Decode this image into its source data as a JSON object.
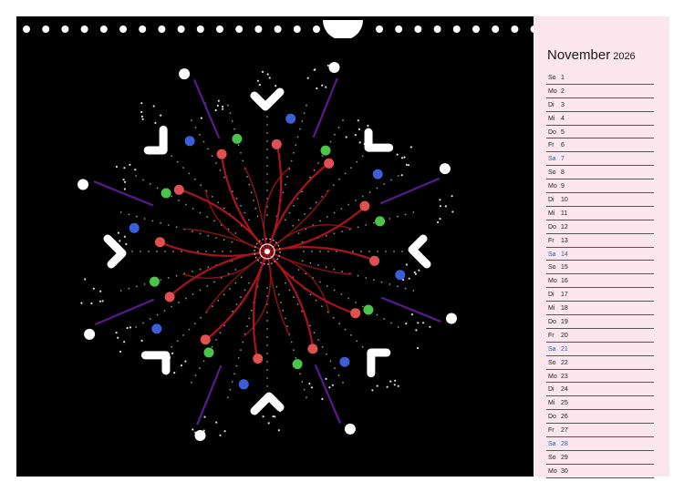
{
  "calendar": {
    "month": "November",
    "year": "2026",
    "days": [
      {
        "weekday": "So",
        "day": "1"
      },
      {
        "weekday": "Mo",
        "day": "2"
      },
      {
        "weekday": "Di",
        "day": "3"
      },
      {
        "weekday": "Mi",
        "day": "4"
      },
      {
        "weekday": "Do",
        "day": "5"
      },
      {
        "weekday": "Fr",
        "day": "6"
      },
      {
        "weekday": "Sa",
        "day": "7"
      },
      {
        "weekday": "So",
        "day": "8"
      },
      {
        "weekday": "Mo",
        "day": "9"
      },
      {
        "weekday": "Di",
        "day": "10"
      },
      {
        "weekday": "Mi",
        "day": "11"
      },
      {
        "weekday": "Do",
        "day": "12"
      },
      {
        "weekday": "Fr",
        "day": "13"
      },
      {
        "weekday": "Sa",
        "day": "14"
      },
      {
        "weekday": "So",
        "day": "15"
      },
      {
        "weekday": "Mo",
        "day": "16"
      },
      {
        "weekday": "Di",
        "day": "17"
      },
      {
        "weekday": "Mi",
        "day": "18"
      },
      {
        "weekday": "Do",
        "day": "19"
      },
      {
        "weekday": "Fr",
        "day": "20"
      },
      {
        "weekday": "Sa",
        "day": "21"
      },
      {
        "weekday": "So",
        "day": "22"
      },
      {
        "weekday": "Mo",
        "day": "23"
      },
      {
        "weekday": "Di",
        "day": "24"
      },
      {
        "weekday": "Mi",
        "day": "25"
      },
      {
        "weekday": "Do",
        "day": "26"
      },
      {
        "weekday": "Fr",
        "day": "27"
      },
      {
        "weekday": "Sa",
        "day": "28"
      },
      {
        "weekday": "So",
        "day": "29"
      },
      {
        "weekday": "Mo",
        "day": "30"
      }
    ]
  },
  "colors": {
    "background": "#000000",
    "panel": "#fbe6ee",
    "saturday": "#2b5fa8",
    "tendril": "#a8141c",
    "purple": "#5a1a8c",
    "green": "#4cc44c",
    "blue": "#3a5fd8",
    "red": "#e05050",
    "white": "#ffffff"
  }
}
